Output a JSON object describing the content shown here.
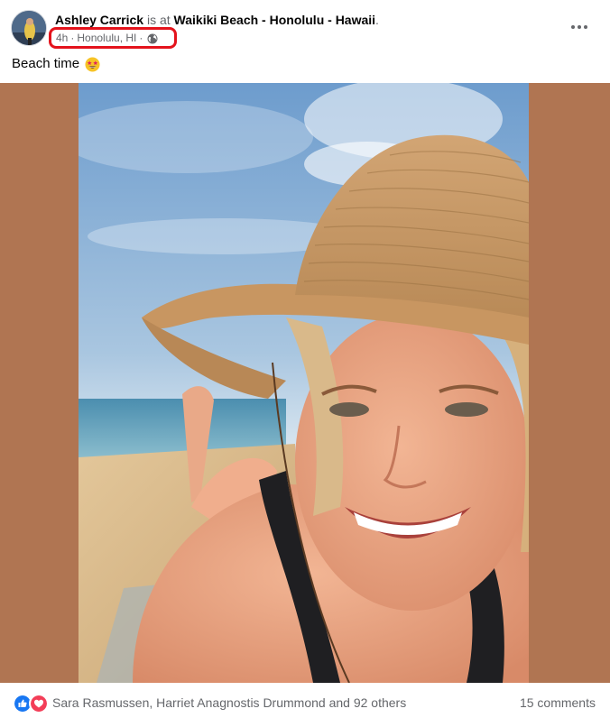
{
  "post": {
    "author": "Ashley Carrick",
    "is_at": "is at",
    "place": "Waikiki Beach - Honolulu - Hawaii",
    "place_suffix": ".",
    "time": "4h",
    "location": "Honolulu, HI",
    "meta_sep": "·",
    "privacy_icon": "globe-icon",
    "more_icon": "more-options-icon",
    "caption": "Beach time",
    "caption_emoji": "star-struck-emoji"
  },
  "footer": {
    "reaction_icons": [
      "like-icon",
      "love-icon"
    ],
    "reactors": "Sara Rasmussen, Harriet Anagnostis Drummond and 92 others",
    "comments": "15 comments"
  },
  "colors": {
    "highlight_outline": "#e4131c",
    "photo_backdrop": "#b07552",
    "like_blue": "#1877f2",
    "love_red": "#f33e58",
    "muted_text": "#65676b"
  }
}
